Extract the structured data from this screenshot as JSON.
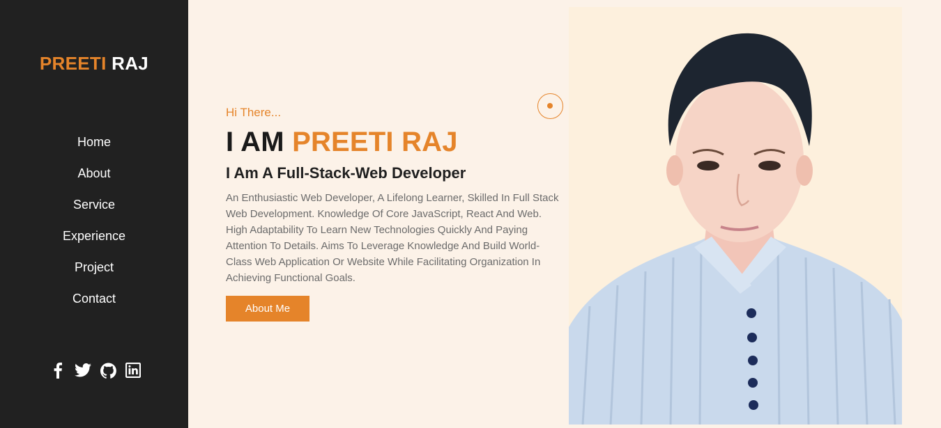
{
  "brand": {
    "first": "PREETI",
    "last": "RAJ"
  },
  "nav": {
    "items": [
      {
        "label": "Home"
      },
      {
        "label": "About"
      },
      {
        "label": "Service"
      },
      {
        "label": "Experience"
      },
      {
        "label": "Project"
      },
      {
        "label": "Contact"
      }
    ]
  },
  "social": [
    "facebook-icon",
    "twitter-icon",
    "github-icon",
    "linkedin-icon"
  ],
  "hero": {
    "greeting": "Hi There...",
    "headline_prefix": "I AM",
    "headline_name": "PREETI RAJ",
    "role": "I Am A Full-Stack-Web Developer",
    "description": "An Enthusiastic Web Developer, A Lifelong Learner, Skilled In Full Stack Web Development. Knowledge Of Core JavaScript, React And Web. High Adaptability To Learn New Technologies Quickly And Paying Attention To Details. Aims To Leverage Knowledge And Build World-Class Web Application Or Website While Facilitating Organization In Achieving Functional Goals.",
    "button_label": "About Me"
  },
  "colors": {
    "accent": "#e5842a",
    "sidebar": "#212121",
    "background": "#fcf2e8"
  }
}
